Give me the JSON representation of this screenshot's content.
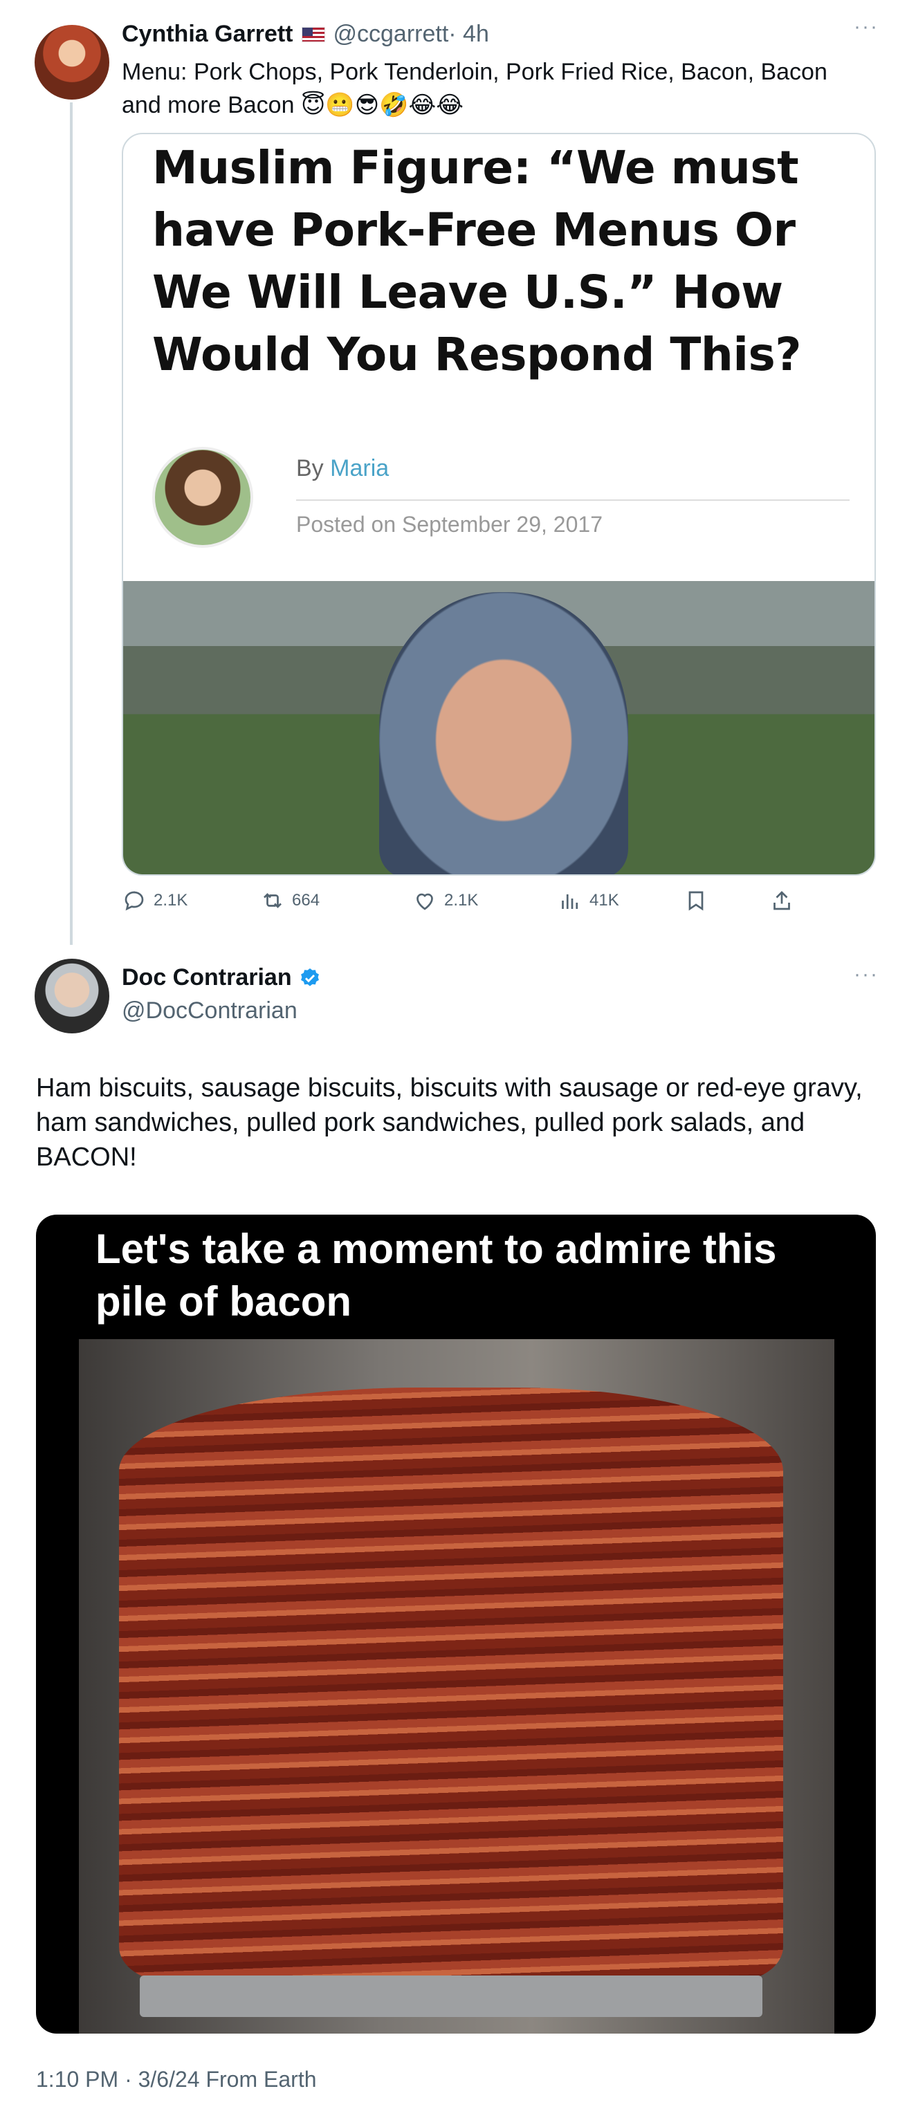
{
  "tweet1": {
    "name": "Cynthia Garrett",
    "handle": "@ccgarrett",
    "time": "· 4h",
    "text": "Menu: Pork Chops, Pork Tenderloin,   Pork Fried Rice, Bacon, Bacon and more Bacon 😇😬😎🤣😂😂",
    "article": {
      "headline": "Muslim Figure: “We must have Pork-Free Menus Or We Will Leave U.S.” How Would You Respond This?",
      "by_prefix": "By",
      "author": "Maria",
      "posted": "Posted on September 29, 2017"
    },
    "actions": {
      "replies": "2.1K",
      "reposts": "664",
      "likes": "2.1K",
      "views": "41K"
    }
  },
  "tweet2": {
    "name": "Doc Contrarian",
    "handle": "@DocContrarian",
    "text": "Ham biscuits, sausage biscuits, biscuits with sausage or red-eye gravy, ham sandwiches, pulled pork sandwiches, pulled pork salads, and BACON!",
    "image_caption": "Let's take a moment to admire this pile of bacon",
    "timestamp": "1:10 PM · 3/6/24 From Earth"
  },
  "colors": {
    "secondary_text": "#536471",
    "verified_blue": "#1d9bf0",
    "thread_line": "#cfd9de"
  },
  "icons": [
    "reply-icon",
    "repost-icon",
    "like-icon",
    "views-icon",
    "bookmark-icon",
    "share-icon",
    "verified-badge-icon",
    "more-icon",
    "us-flag-icon"
  ]
}
